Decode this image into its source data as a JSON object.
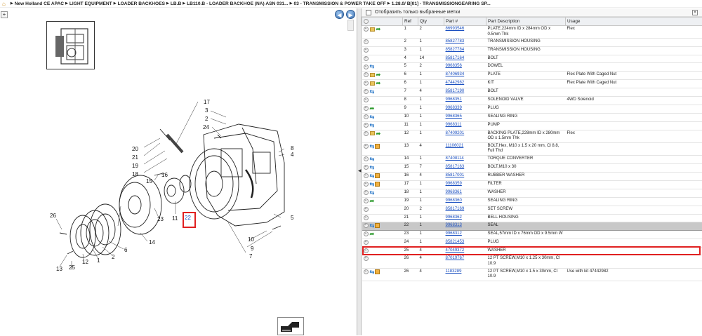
{
  "breadcrumb": [
    "New Holland CE APAC",
    "LIGHT EQUIPMENT",
    "LOADER BACKHOES",
    "LB.B",
    "LB110.B - LOADER BACKHOE (NA) ASN 031...",
    "03 - TRANSMISSION & POWER TAKE OFF",
    "1.28.0/ B[01] - TRANSMISSIONGEARING SP..."
  ],
  "filter_label": "Отобразить только выбранные метки",
  "columns": {
    "ref": "Ref",
    "qty": "Qty",
    "part": "Part #",
    "desc": "Part Description",
    "usage": "Usage"
  },
  "parts": [
    {
      "icons": "fa",
      "ref": "1",
      "qty": "2",
      "part": "86993546",
      "desc": "PLATE,224mm ID x 284mm OD x 0.5mm Thk",
      "usage": "Flex"
    },
    {
      "icons": "",
      "ref": "2",
      "qty": "1",
      "part": "85827783",
      "desc": "TRANSMISSION HOUSING",
      "usage": ""
    },
    {
      "icons": "",
      "ref": "3",
      "qty": "1",
      "part": "85827784",
      "desc": "TRANSMISSION HOUSING",
      "usage": ""
    },
    {
      "icons": "",
      "ref": "4",
      "qty": "14",
      "part": "85817164",
      "desc": "BOLT",
      "usage": ""
    },
    {
      "icons": "s",
      "ref": "5",
      "qty": "2",
      "part": "9968356",
      "desc": "DOWEL",
      "usage": ""
    },
    {
      "icons": "fa",
      "ref": "6",
      "qty": "1",
      "part": "87406934",
      "desc": "PLATE",
      "usage": "Flex Plate With Caged Nut"
    },
    {
      "icons": "fa",
      "ref": "6",
      "qty": "1",
      "part": "47442982",
      "desc": "KIT",
      "usage": "Flex Plate With Caged Nut"
    },
    {
      "icons": "s",
      "ref": "7",
      "qty": "4",
      "part": "85817190",
      "desc": "BOLT",
      "usage": ""
    },
    {
      "icons": "",
      "ref": "8",
      "qty": "1",
      "part": "9968351",
      "desc": "SOLENOID VALVE",
      "usage": "4WD Solenoid"
    },
    {
      "icons": "a",
      "ref": "9",
      "qty": "1",
      "part": "9968339",
      "desc": "PLUG",
      "usage": ""
    },
    {
      "icons": "s",
      "ref": "10",
      "qty": "1",
      "part": "9968365",
      "desc": "SEALING RING",
      "usage": ""
    },
    {
      "icons": "s",
      "ref": "11",
      "qty": "1",
      "part": "9968311",
      "desc": "PUMP",
      "usage": ""
    },
    {
      "icons": "fa",
      "ref": "12",
      "qty": "1",
      "part": "87409201",
      "desc": "BACKING PLATE,228mm ID x 280mm OD x 1.5mm Thk",
      "usage": "Flex"
    },
    {
      "icons": "sb",
      "ref": "13",
      "qty": "4",
      "part": "11106021",
      "desc": "BOLT,Hex, M10 x 1.5 x 20 mm, Cl 8.8, Full Thd",
      "usage": ""
    },
    {
      "icons": "s",
      "ref": "14",
      "qty": "1",
      "part": "87408114",
      "desc": "TORQUE CONVERTER",
      "usage": ""
    },
    {
      "icons": "s",
      "ref": "15",
      "qty": "7",
      "part": "85817163",
      "desc": "BOLT,M10 x 30",
      "usage": ""
    },
    {
      "icons": "sb",
      "ref": "16",
      "qty": "4",
      "part": "85817001",
      "desc": "RUBBER WASHER",
      "usage": ""
    },
    {
      "icons": "sb",
      "ref": "17",
      "qty": "1",
      "part": "9968359",
      "desc": "FILTER",
      "usage": ""
    },
    {
      "icons": "s",
      "ref": "18",
      "qty": "1",
      "part": "9968361",
      "desc": "WASHER",
      "usage": ""
    },
    {
      "icons": "a",
      "ref": "19",
      "qty": "1",
      "part": "9968360",
      "desc": "SEALING RING",
      "usage": ""
    },
    {
      "icons": "",
      "ref": "20",
      "qty": "2",
      "part": "85817169",
      "desc": "SET SCREW",
      "usage": ""
    },
    {
      "icons": "",
      "ref": "21",
      "qty": "1",
      "part": "9968362",
      "desc": "BELL HOUSING",
      "usage": ""
    },
    {
      "icons": "sb",
      "ref": "22",
      "qty": "1",
      "part": "9968313",
      "desc": "SEAL",
      "usage": "",
      "selected": true
    },
    {
      "icons": "a",
      "ref": "23",
      "qty": "1",
      "part": "9968312",
      "desc": "SEAL,57mm ID x 76mm OD x 9.5mm W",
      "usage": ""
    },
    {
      "icons": "",
      "ref": "24",
      "qty": "1",
      "part": "85821453",
      "desc": "PLUG",
      "usage": ""
    },
    {
      "icons": "",
      "ref": "25",
      "qty": "4",
      "part": "47049372",
      "desc": "WASHER",
      "usage": ""
    },
    {
      "icons": "",
      "ref": "26",
      "qty": "4",
      "part": "87019767",
      "desc": "12 PT SCREW,M10 x 1.25 x 30mm, Cl 10.9",
      "usage": ""
    },
    {
      "icons": "sb",
      "ref": "26",
      "qty": "4",
      "part": "1183289",
      "desc": "12 PT SCREW,M10 x 1.5 x 30mm, Cl 10.9",
      "usage": "Use with kit 47442982"
    }
  ],
  "callouts": [
    "1",
    "2",
    "3",
    "4",
    "5",
    "6",
    "7",
    "8",
    "9",
    "10",
    "11",
    "12",
    "13",
    "14",
    "15",
    "16",
    "17",
    "18",
    "19",
    "20",
    "21",
    "22",
    "23",
    "24",
    "25",
    "26"
  ],
  "selected_callout": "22"
}
